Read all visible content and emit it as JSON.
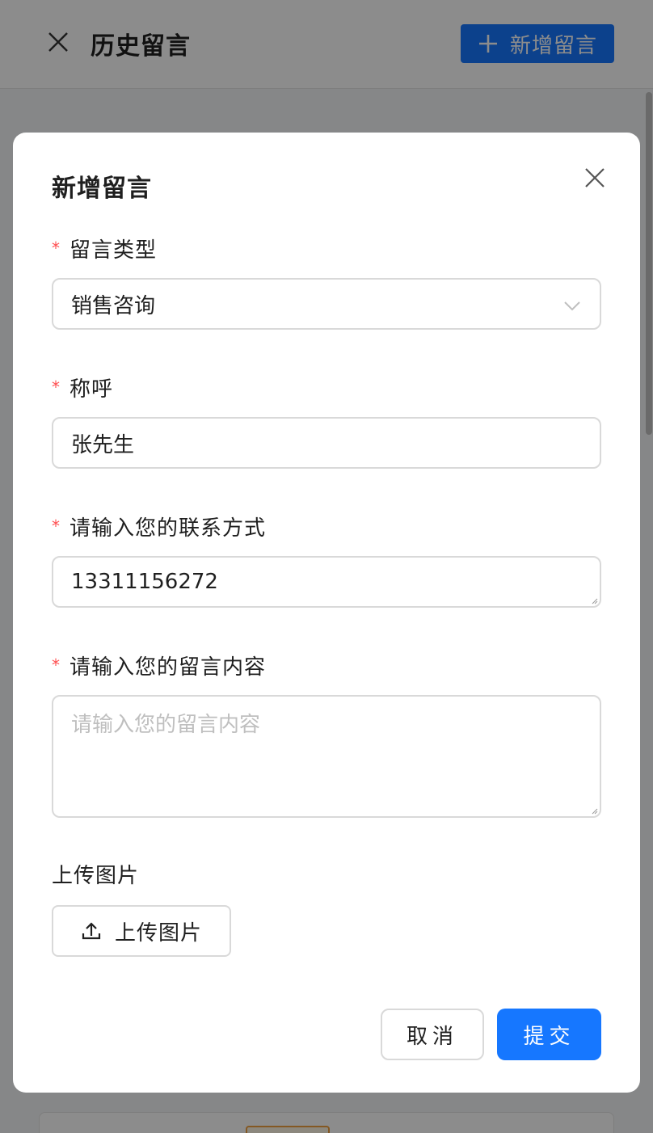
{
  "header": {
    "title": "历史留言",
    "add_label": "新增留言"
  },
  "modal": {
    "title": "新增留言",
    "fields": {
      "type": {
        "label": "留言类型",
        "value": "销售咨询",
        "required": true
      },
      "name": {
        "label": "称呼",
        "value": "张先生",
        "required": true
      },
      "contact": {
        "label": "请输入您的联系方式",
        "value": "13311156272",
        "required": true
      },
      "content": {
        "label": "请输入您的留言内容",
        "placeholder": "请输入您的留言内容",
        "value": "",
        "required": true
      }
    },
    "upload": {
      "label": "上传图片",
      "button_label": "上传图片"
    },
    "cancel_label": "取消",
    "submit_label": "提交"
  },
  "colors": {
    "primary": "#1677ff",
    "required": "#ff4d4f",
    "border": "#d9d9d9"
  },
  "icons": [
    "close-icon",
    "plus-icon",
    "chevron-down-icon",
    "upload-icon"
  ]
}
